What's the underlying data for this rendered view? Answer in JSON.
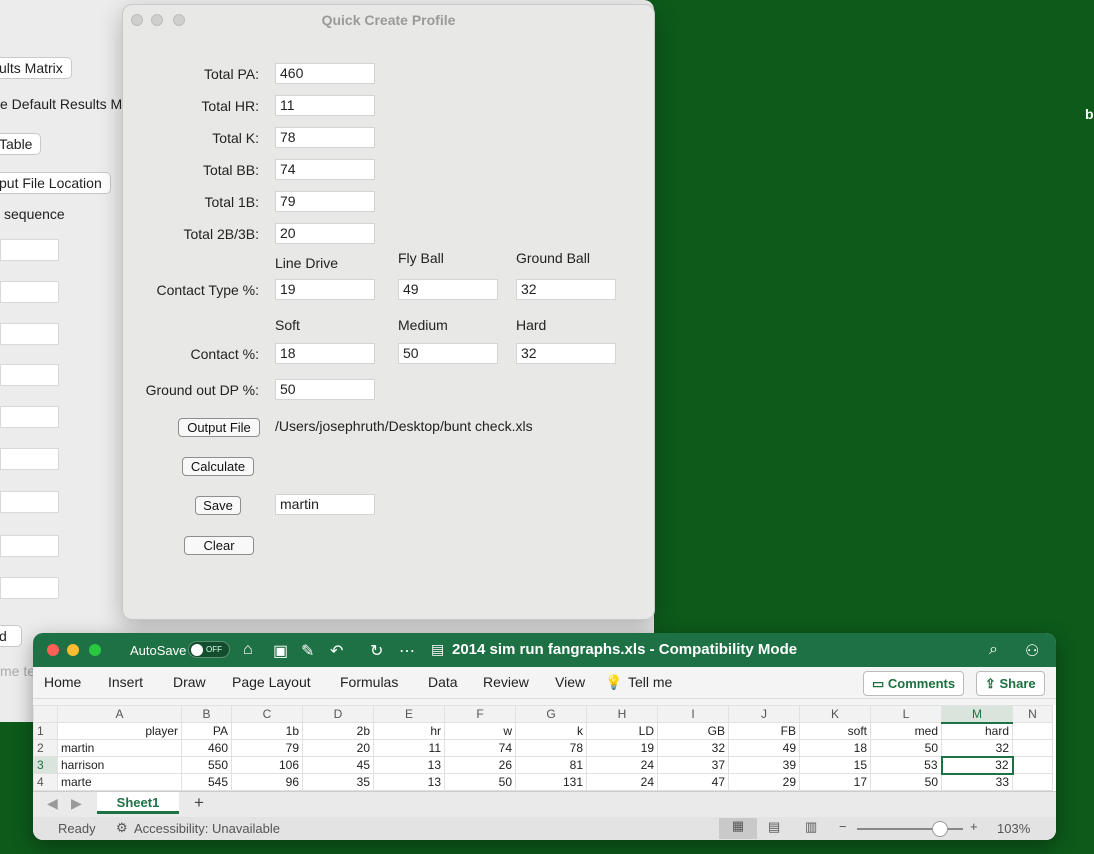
{
  "desktop": {
    "edge_letter": "b"
  },
  "bg_window": {
    "btn_results_matrix": "ults Matrix",
    "text_default_results": "e Default Results M",
    "btn_table": "Table",
    "btn_output_location": "put File Location",
    "text_sequence": "sequence",
    "btn_bottom_left": "d",
    "text_bottom_hint": "me te"
  },
  "dialog": {
    "title": "Quick Create Profile",
    "labels": {
      "total_pa": "Total PA:",
      "total_hr": "Total HR:",
      "total_k": "Total K:",
      "total_bb": "Total BB:",
      "total_1b": "Total 1B:",
      "total_2b3b": "Total 2B/3B:",
      "contact_type": "Contact Type %:",
      "contact": "Contact %:",
      "ground_dp": "Ground out DP %:"
    },
    "values": {
      "total_pa": "460",
      "total_hr": "11",
      "total_k": "78",
      "total_bb": "74",
      "total_1b": "79",
      "total_2b3b": "20",
      "line_drive": "19",
      "fly_ball": "49",
      "ground_ball": "32",
      "soft": "18",
      "medium": "50",
      "hard": "32",
      "ground_dp": "50",
      "save_name": "martin"
    },
    "column_heads": {
      "line_drive": "Line Drive",
      "fly_ball": "Fly Ball",
      "ground_ball": "Ground Ball",
      "soft": "Soft",
      "medium": "Medium",
      "hard": "Hard"
    },
    "buttons": {
      "output_file": "Output File",
      "calculate": "Calculate",
      "save": "Save",
      "clear": "Clear"
    },
    "output_path": "/Users/josephruth/Desktop/bunt check.xls"
  },
  "excel": {
    "autosave_label": "AutoSave",
    "autosave_state": "OFF",
    "title": "2014 sim run fangraphs.xls  -  Compatibility Mode",
    "menu": [
      "Home",
      "Insert",
      "Draw",
      "Page Layout",
      "Formulas",
      "Data",
      "Review",
      "View",
      "Tell me"
    ],
    "comments_label": "Comments",
    "share_label": "Share",
    "columns": [
      "A",
      "B",
      "C",
      "D",
      "E",
      "F",
      "G",
      "H",
      "I",
      "J",
      "K",
      "L",
      "M",
      "N"
    ],
    "rows": [
      {
        "num": "1",
        "cells": [
          "player",
          "PA",
          "1b",
          "2b",
          "hr",
          "w",
          "k",
          "LD",
          "GB",
          "FB",
          "soft",
          "med",
          "hard"
        ]
      },
      {
        "num": "2",
        "cells": [
          "martin",
          "460",
          "79",
          "20",
          "11",
          "74",
          "78",
          "19",
          "32",
          "49",
          "18",
          "50",
          "32"
        ]
      },
      {
        "num": "3",
        "cells": [
          "harrison",
          "550",
          "106",
          "45",
          "13",
          "26",
          "81",
          "24",
          "37",
          "39",
          "15",
          "53",
          "32"
        ]
      },
      {
        "num": "4",
        "cells": [
          "marte",
          "545",
          "96",
          "35",
          "13",
          "50",
          "131",
          "24",
          "47",
          "29",
          "17",
          "50",
          "33"
        ]
      }
    ],
    "sheet_tab": "Sheet1",
    "status": "Ready",
    "accessibility": "Accessibility: Unavailable",
    "zoom": "103%",
    "zoom_fraction": 0.5
  }
}
